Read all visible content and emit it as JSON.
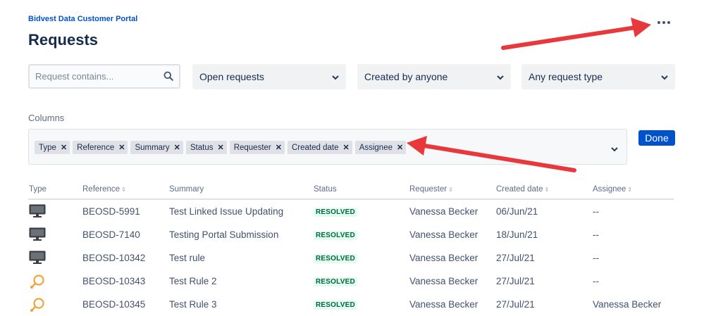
{
  "header": {
    "portal_link": "Bidvest Data Customer Portal",
    "title": "Requests"
  },
  "filters": {
    "search_placeholder": "Request contains...",
    "status": "Open requests",
    "creator": "Created by anyone",
    "type": "Any request type"
  },
  "columns": {
    "label": "Columns",
    "chips": [
      "Type",
      "Reference",
      "Summary",
      "Status",
      "Requester",
      "Created date",
      "Assignee"
    ],
    "done_label": "Done"
  },
  "table": {
    "headers": [
      "Type",
      "Reference",
      "Summary",
      "Status",
      "Requester",
      "Created date",
      "Assignee"
    ],
    "rows": [
      {
        "type_icon": "monitor-icon",
        "reference": "BEOSD-5991",
        "summary": "Test Linked Issue Updating",
        "status": "RESOLVED",
        "requester": "Vanessa Becker",
        "created": "06/Jun/21",
        "assignee": "--"
      },
      {
        "type_icon": "monitor-icon",
        "reference": "BEOSD-7140",
        "summary": "Testing Portal Submission",
        "status": "RESOLVED",
        "requester": "Vanessa Becker",
        "created": "18/Jun/21",
        "assignee": "--"
      },
      {
        "type_icon": "monitor-icon",
        "reference": "BEOSD-10342",
        "summary": "Test rule",
        "status": "RESOLVED",
        "requester": "Vanessa Becker",
        "created": "27/Jul/21",
        "assignee": "--"
      },
      {
        "type_icon": "support-icon",
        "reference": "BEOSD-10343",
        "summary": "Test Rule 2",
        "status": "RESOLVED",
        "requester": "Vanessa Becker",
        "created": "27/Jul/21",
        "assignee": "--"
      },
      {
        "type_icon": "support-icon",
        "reference": "BEOSD-10345",
        "summary": "Test Rule 3",
        "status": "RESOLVED",
        "requester": "Vanessa Becker",
        "created": "27/Jul/21",
        "assignee": "Vanessa Becker"
      }
    ]
  },
  "colors": {
    "accent": "#0052cc",
    "resolved_bg": "#e3fcef",
    "resolved_text": "#006644",
    "annotation_arrow": "#e8383b"
  }
}
